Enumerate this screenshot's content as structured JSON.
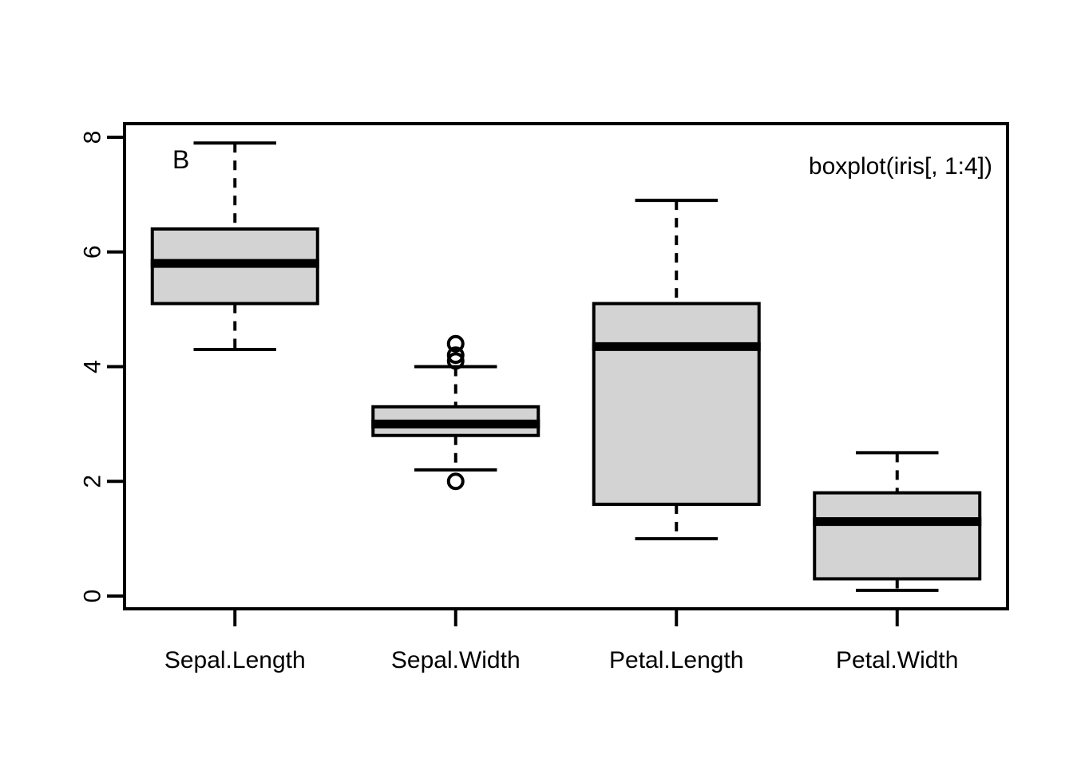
{
  "chart_data": {
    "type": "box",
    "title": "",
    "subtitle": "",
    "xlabel": "",
    "ylabel": "",
    "panel_label": "B",
    "annotation": {
      "text": "boxplot(iris[, 1:4])",
      "color": "#FF0000",
      "position": "top-right"
    },
    "grid": false,
    "legend": "none",
    "box_fill_color": "#D3D3D3",
    "box_line_color": "#000000",
    "frame_color": "#000000",
    "background_color": "#FFFFFF",
    "ylim": [
      -0.15,
      8.25
    ],
    "yticks": [
      0,
      2,
      4,
      6,
      8
    ],
    "ytick_labels": [
      "0",
      "2",
      "4",
      "6",
      "8"
    ],
    "ytick_label_rotation": -90,
    "categories": [
      "Sepal.Length",
      "Sepal.Width",
      "Petal.Length",
      "Petal.Width"
    ],
    "series": [
      {
        "name": "Sepal.Length",
        "min": 4.3,
        "q1": 5.1,
        "median": 5.8,
        "q3": 6.4,
        "max": 7.9,
        "outliers": []
      },
      {
        "name": "Sepal.Width",
        "min": 2.2,
        "q1": 2.8,
        "median": 3.0,
        "q3": 3.3,
        "max": 4.0,
        "outliers": [
          4.4,
          4.2,
          4.1,
          2.0
        ]
      },
      {
        "name": "Petal.Length",
        "min": 1.0,
        "q1": 1.6,
        "median": 4.35,
        "q3": 5.1,
        "max": 6.9,
        "outliers": []
      },
      {
        "name": "Petal.Width",
        "min": 0.1,
        "q1": 0.3,
        "median": 1.3,
        "q3": 1.8,
        "max": 2.5,
        "outliers": []
      }
    ]
  }
}
